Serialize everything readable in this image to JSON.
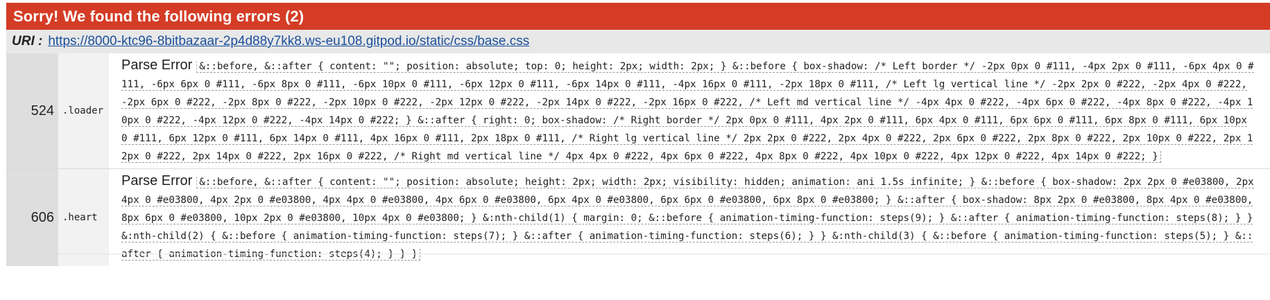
{
  "header": {
    "title": "Sorry! We found the following errors (2)",
    "background_color": "#d43c26"
  },
  "uri": {
    "label": "URI :",
    "link": "https://8000-ktc96-8bitbazaar-2p4d88y7kk8.ws-eu108.gitpod.io/static/css/base.css"
  },
  "errors": [
    {
      "line": "524",
      "context": ".loader",
      "type": "Parse Error",
      "message": "&::before, &::after { content: \"\"; position: absolute; top: 0; height: 2px; width: 2px; } &::before { box-shadow: /* Left border */ -2px 0px 0 #111, -4px 2px 0 #111, -6px 4px 0 #111, -6px 6px 0 #111, -6px 8px 0 #111, -6px 10px 0 #111, -6px 12px 0 #111, -6px 14px 0 #111, -4px 16px 0 #111, -2px 18px 0 #111, /* Left lg vertical line */ -2px 2px 0 #222, -2px 4px 0 #222, -2px 6px 0 #222, -2px 8px 0 #222, -2px 10px 0 #222, -2px 12px 0 #222, -2px 14px 0 #222, -2px 16px 0 #222, /* Left md vertical line */ -4px 4px 0 #222, -4px 6px 0 #222, -4px 8px 0 #222, -4px 10px 0 #222, -4px 12px 0 #222, -4px 14px 0 #222; } &::after { right: 0; box-shadow: /* Right border */ 2px 0px 0 #111, 4px 2px 0 #111, 6px 4px 0 #111, 6px 6px 0 #111, 6px 8px 0 #111, 6px 10px 0 #111, 6px 12px 0 #111, 6px 14px 0 #111, 4px 16px 0 #111, 2px 18px 0 #111, /* Right lg vertical line */ 2px 2px 0 #222, 2px 4px 0 #222, 2px 6px 0 #222, 2px 8px 0 #222, 2px 10px 0 #222, 2px 12px 0 #222, 2px 14px 0 #222, 2px 16px 0 #222, /* Right md vertical line */ 4px 4px 0 #222, 4px 6px 0 #222, 4px 8px 0 #222, 4px 10px 0 #222, 4px 12px 0 #222, 4px 14px 0 #222; }"
    },
    {
      "line": "606",
      "context": ".heart",
      "type": "Parse Error",
      "message": "&::before, &::after { content: \"\"; position: absolute; height: 2px; width: 2px; visibility: hidden; animation: ani 1.5s infinite; } &::before { box-shadow: 2px 2px 0 #e03800, 2px 4px 0 #e03800, 4px 2px 0 #e03800, 4px 4px 0 #e03800, 4px 6px 0 #e03800, 6px 4px 0 #e03800, 6px 6px 0 #e03800, 6px 8px 0 #e03800; } &::after { box-shadow: 8px 2px 0 #e03800, 8px 4px 0 #e03800, 8px 6px 0 #e03800, 10px 2px 0 #e03800, 10px 4px 0 #e03800; } &:nth-child(1) { margin: 0; &::before { animation-timing-function: steps(9); } &::after { animation-timing-function: steps(8); } } &:nth-child(2) { &::before { animation-timing-function: steps(7); } &::after { animation-timing-function: steps(6); } } &:nth-child(3) { &::before { animation-timing-function: steps(5); } &::after { animation-timing-function: steps(4); } } }"
    }
  ]
}
